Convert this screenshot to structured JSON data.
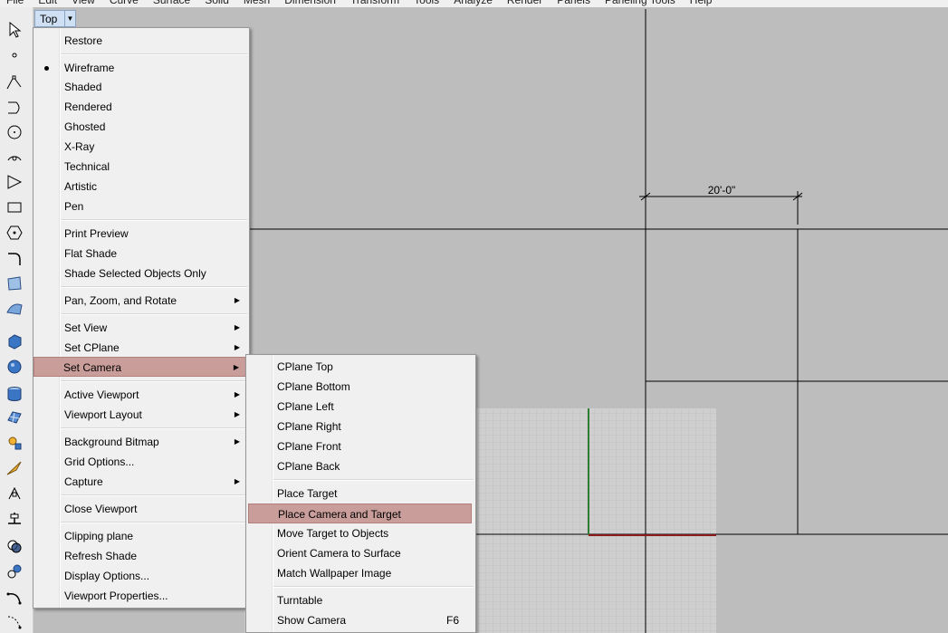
{
  "menubar": [
    "File",
    "Edit",
    "View",
    "Curve",
    "Surface",
    "Solid",
    "Mesh",
    "Dimension",
    "Transform",
    "Tools",
    "Analyze",
    "Render",
    "Panels",
    "Paneling Tools",
    "Help"
  ],
  "viewport": {
    "name": "Top",
    "dimension_label": "20'-0\""
  },
  "viewport_menu": {
    "restore": "Restore",
    "display_modes": [
      "Wireframe",
      "Shaded",
      "Rendered",
      "Ghosted",
      "X-Ray",
      "Technical",
      "Artistic",
      "Pen"
    ],
    "active_mode": "Wireframe",
    "print_preview": "Print Preview",
    "flat_shade": "Flat Shade",
    "shade_selected": "Shade Selected Objects Only",
    "pan_zoom_rotate": "Pan, Zoom, and Rotate",
    "set_view": "Set View",
    "set_cplane": "Set CPlane",
    "set_camera": "Set Camera",
    "active_viewport": "Active Viewport",
    "viewport_layout": "Viewport Layout",
    "background_bitmap": "Background Bitmap",
    "grid_options": "Grid Options...",
    "capture": "Capture",
    "close_viewport": "Close Viewport",
    "clipping_plane": "Clipping plane",
    "refresh_shade": "Refresh Shade",
    "display_options": "Display Options...",
    "viewport_properties": "Viewport Properties..."
  },
  "camera_menu": {
    "cplane_top": "CPlane Top",
    "cplane_bottom": "CPlane Bottom",
    "cplane_left": "CPlane Left",
    "cplane_right": "CPlane Right",
    "cplane_front": "CPlane Front",
    "cplane_back": "CPlane Back",
    "place_target": "Place Target",
    "place_camera_and_target": "Place Camera and Target",
    "move_target": "Move Target to Objects",
    "orient_camera": "Orient Camera to Surface",
    "match_wallpaper": "Match Wallpaper Image",
    "turntable": "Turntable",
    "show_camera": "Show Camera",
    "show_camera_shortcut": "F6"
  },
  "colors": {
    "highlight": "#c89d9a",
    "viewport_bg": "#bdbdbd",
    "grid_bg": "#cfcfcf",
    "x_axis": "#8b1a1a",
    "y_axis": "#2e7d32"
  }
}
